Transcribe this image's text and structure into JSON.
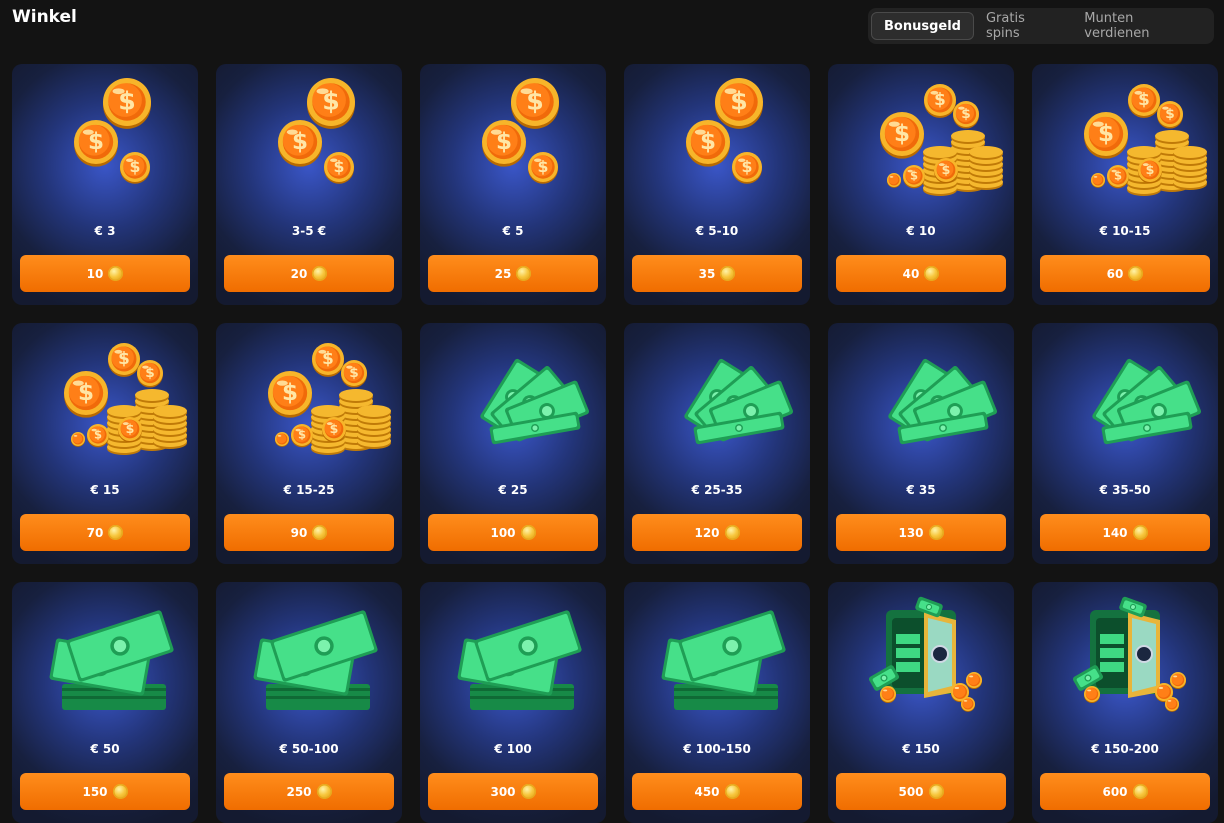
{
  "header": {
    "title": "Winkel",
    "tabs": [
      {
        "label": "Bonusgeld",
        "active": true
      },
      {
        "label": "Gratis spins",
        "active": false
      },
      {
        "label": "Munten verdienen",
        "active": false
      }
    ]
  },
  "colors": {
    "button": "#f97c0f",
    "card_glow": "#3a56c8",
    "background": "#131313"
  },
  "items": [
    {
      "label": "€ 3",
      "price": "10",
      "art": "coins-small-icon"
    },
    {
      "label": "3-5  €",
      "price": "20",
      "art": "coins-small-icon"
    },
    {
      "label": "€ 5",
      "price": "25",
      "art": "coins-small-icon"
    },
    {
      "label": "€ 5-10",
      "price": "35",
      "art": "coins-small-icon"
    },
    {
      "label": "€ 10",
      "price": "40",
      "art": "coin-pile-icon"
    },
    {
      "label": "€ 10-15",
      "price": "60",
      "art": "coin-pile-icon"
    },
    {
      "label": "€ 15",
      "price": "70",
      "art": "coin-pile-icon"
    },
    {
      "label": "€ 15-25",
      "price": "90",
      "art": "coin-pile-icon"
    },
    {
      "label": "€ 25",
      "price": "100",
      "art": "banknotes-fan-icon"
    },
    {
      "label": "€ 25-35",
      "price": "120",
      "art": "banknotes-fan-icon"
    },
    {
      "label": "€ 35",
      "price": "130",
      "art": "banknotes-fan-icon"
    },
    {
      "label": "€ 35-50",
      "price": "140",
      "art": "banknotes-fan-icon"
    },
    {
      "label": "€ 50",
      "price": "150",
      "art": "cash-stack-icon"
    },
    {
      "label": "€ 50-100",
      "price": "250",
      "art": "cash-stack-icon"
    },
    {
      "label": "€ 100",
      "price": "300",
      "art": "cash-stack-icon"
    },
    {
      "label": "€ 100-150",
      "price": "450",
      "art": "cash-stack-icon"
    },
    {
      "label": "€ 150",
      "price": "500",
      "art": "money-safe-icon"
    },
    {
      "label": "€ 150-200",
      "price": "600",
      "art": "money-safe-icon"
    }
  ]
}
